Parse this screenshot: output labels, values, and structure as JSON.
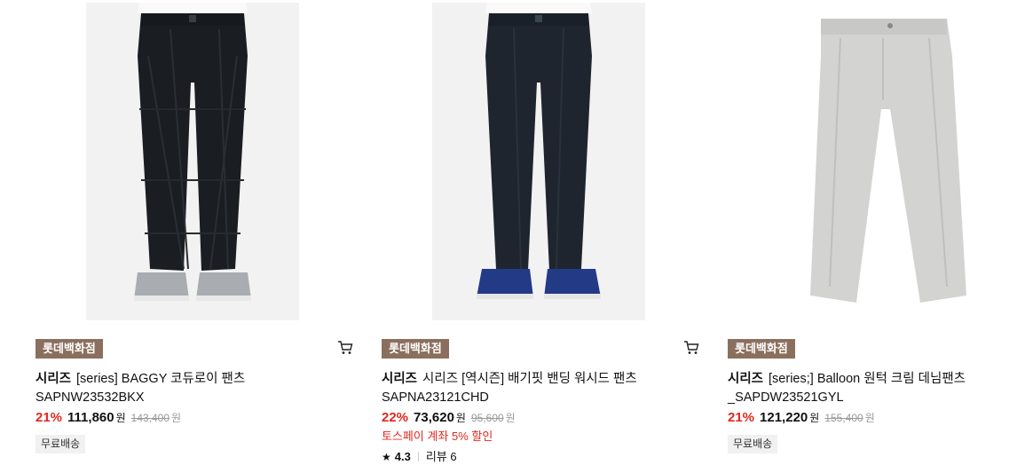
{
  "products": [
    {
      "badge": "롯데백화점",
      "brand": "시리즈",
      "name": "[series] BAGGY 코듀로이 팬츠 SAPNW23532BKX",
      "discount_rate": "21%",
      "sale_price": "111,860",
      "sale_unit": "원",
      "original_price": "143,400",
      "original_unit": "원",
      "tag": "무료배송",
      "image": "black corduroy baggy pants on model with grey sneakers"
    },
    {
      "badge": "롯데백화점",
      "brand": "시리즈",
      "name": "시리즈 [역시즌] 배기핏 밴딩 워시드 팬츠 SAPNA23121CHD",
      "discount_rate": "22%",
      "sale_price": "73,620",
      "sale_unit": "원",
      "original_price": "95,600",
      "original_unit": "원",
      "promo": "토스페이 계좌 5% 할인",
      "rating": "4.3",
      "reviews": "리뷰 6",
      "image": "navy washed pants on model with navy sneakers"
    },
    {
      "badge": "롯데백화점",
      "brand": "시리즈",
      "name": "[series;] Balloon 원턱 크림 데님팬츠 _SAPDW23521GYL",
      "discount_rate": "21%",
      "sale_price": "121,220",
      "sale_unit": "원",
      "original_price": "155,400",
      "original_unit": "원",
      "tag": "무료배송",
      "image": "light grey balloon denim pants flat lay"
    }
  ],
  "colors": {
    "badge_bg": "#8b6f5e",
    "discount": "#e0281f",
    "strike": "#999999"
  },
  "icons": [
    "cart-icon",
    "star-icon"
  ]
}
